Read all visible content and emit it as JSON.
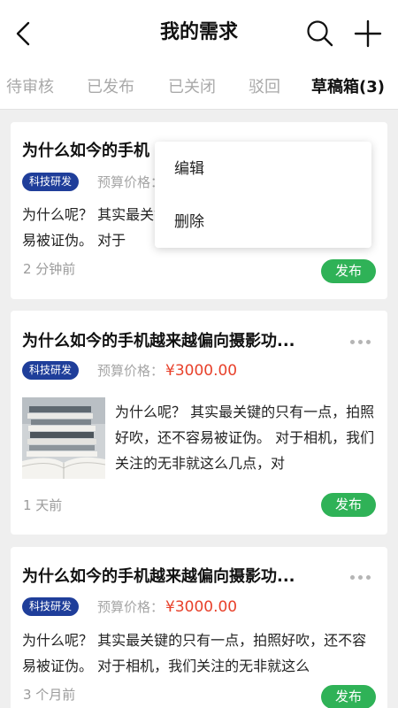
{
  "header": {
    "title": "我的需求",
    "back_icon": "chevron-left-icon",
    "search_icon": "search-icon",
    "add_icon": "plus-icon"
  },
  "tabs": [
    {
      "label": "待审核",
      "active": false
    },
    {
      "label": "已发布",
      "active": false
    },
    {
      "label": "已关闭",
      "active": false
    },
    {
      "label": "驳回",
      "active": false
    },
    {
      "label": "草稿箱(3)",
      "active": true
    }
  ],
  "cards": [
    {
      "title": "为什么如今的手机",
      "tag": "科技研发",
      "budget_label": "预算价格：",
      "description": "为什么呢？ 其实最关键的只有一点，拍照好吹，还不容易被证伪。 对于",
      "time": "2 分钟前",
      "action": "发布"
    },
    {
      "title": "为什么如今的手机越来越偏向摄影功...",
      "tag": "科技研发",
      "budget_label": "预算价格：",
      "budget_value": "¥3000.00",
      "description": "为什么呢？ 其实最关键的只有一点，拍照好吹，还不容易被证伪。 对于相机，我们关注的无非就这么几点，对",
      "time": "1 天前",
      "action": "发布"
    },
    {
      "title": "为什么如今的手机越来越偏向摄影功...",
      "tag": "科技研发",
      "budget_label": "预算价格：",
      "budget_value": "¥3000.00",
      "description": "为什么呢？ 其实最关键的只有一点，拍照好吹，还不容易被证伪。 对于相机，我们关注的无非就这么",
      "time": "3 个月前",
      "action": "发布"
    }
  ],
  "popup_menu": {
    "items": [
      "编辑",
      "删除"
    ]
  },
  "colors": {
    "accent_green": "#2fb257",
    "tag_blue": "#1f3e9a",
    "price_red": "#e8412b"
  }
}
